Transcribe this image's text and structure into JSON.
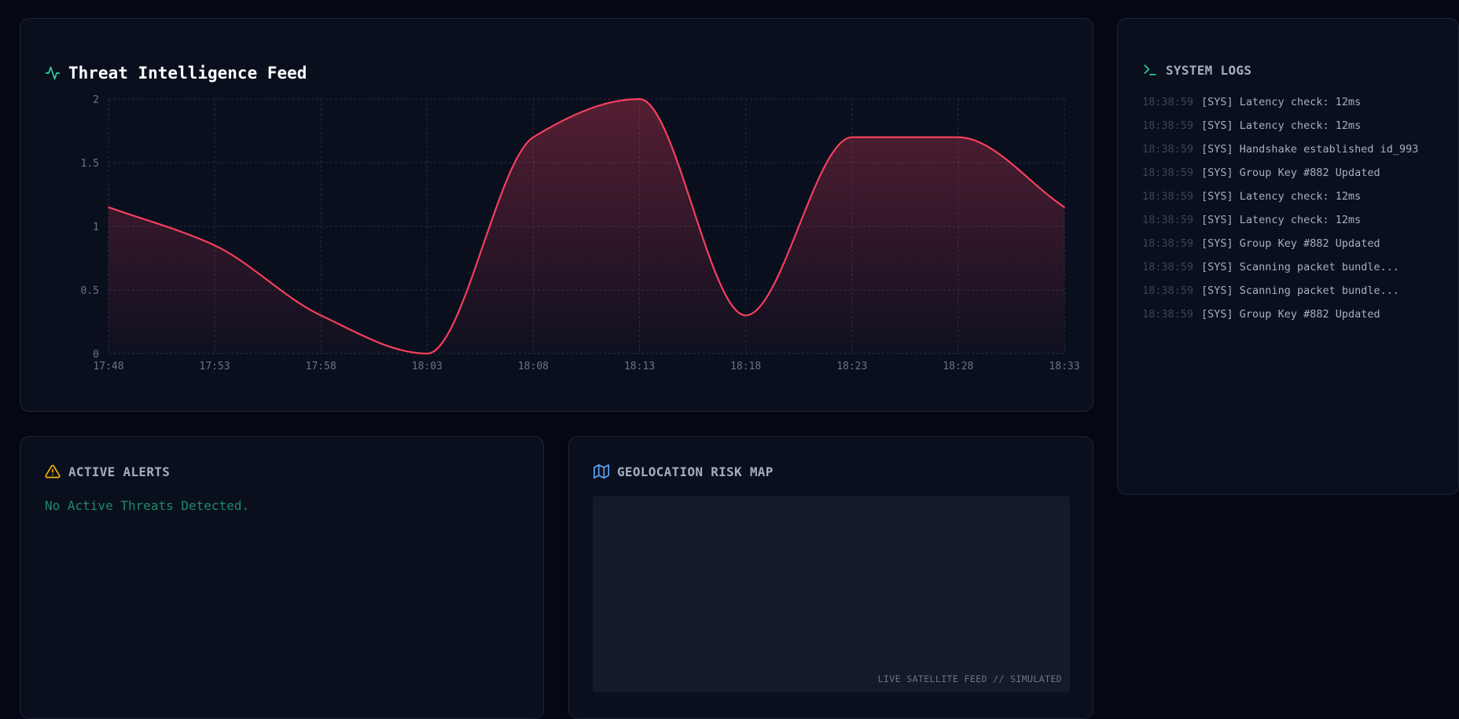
{
  "colors": {
    "background": "#050814",
    "panel": "#0a0f1e",
    "panel_border": "#1c2436",
    "accent_teal": "#34d399",
    "threat_line": "#f43f5e",
    "alert_yellow": "#f5b50a",
    "map_blue": "#60a5fa",
    "ok_green": "#1f8a63"
  },
  "threat_feed": {
    "title": "Threat Intelligence Feed",
    "icon": "activity-pulse-icon"
  },
  "chart_data": {
    "type": "area",
    "title": "Threat Intelligence Feed",
    "xlabel": "",
    "ylabel": "",
    "x": [
      "17:48",
      "17:53",
      "17:58",
      "18:03",
      "18:08",
      "18:13",
      "18:18",
      "18:23",
      "18:28",
      "18:33"
    ],
    "xlim": [
      "17:48",
      "18:33"
    ],
    "ylim": [
      0,
      2
    ],
    "yticks": [
      "0",
      "0.5",
      "1",
      "1.5",
      "2"
    ],
    "grid": true,
    "legend": "none",
    "series": [
      {
        "values": [
          1.15,
          0.85,
          0.3,
          0,
          1.7,
          2.0,
          0.3,
          1.7,
          1.7,
          1.15
        ]
      }
    ]
  },
  "logs": {
    "title": "SYSTEM LOGS",
    "icon": "terminal-icon",
    "entries": [
      {
        "time": "18:38:59",
        "msg": "[SYS] Latency check: 12ms"
      },
      {
        "time": "18:38:59",
        "msg": "[SYS] Latency check: 12ms"
      },
      {
        "time": "18:38:59",
        "msg": "[SYS] Handshake established id_993"
      },
      {
        "time": "18:38:59",
        "msg": "[SYS] Group Key #882 Updated"
      },
      {
        "time": "18:38:59",
        "msg": "[SYS] Latency check: 12ms"
      },
      {
        "time": "18:38:59",
        "msg": "[SYS] Latency check: 12ms"
      },
      {
        "time": "18:38:59",
        "msg": "[SYS] Group Key #882 Updated"
      },
      {
        "time": "18:38:59",
        "msg": "[SYS] Scanning packet bundle..."
      },
      {
        "time": "18:38:59",
        "msg": "[SYS] Scanning packet bundle..."
      },
      {
        "time": "18:38:59",
        "msg": "[SYS] Group Key #882 Updated"
      }
    ]
  },
  "alerts": {
    "title": "ACTIVE ALERTS",
    "icon": "warning-triangle-icon",
    "empty_message": "No Active Threats Detected."
  },
  "geo": {
    "title": "GEOLOCATION RISK MAP",
    "icon": "map-icon",
    "caption": "LIVE SATELLITE FEED // SIMULATED"
  }
}
